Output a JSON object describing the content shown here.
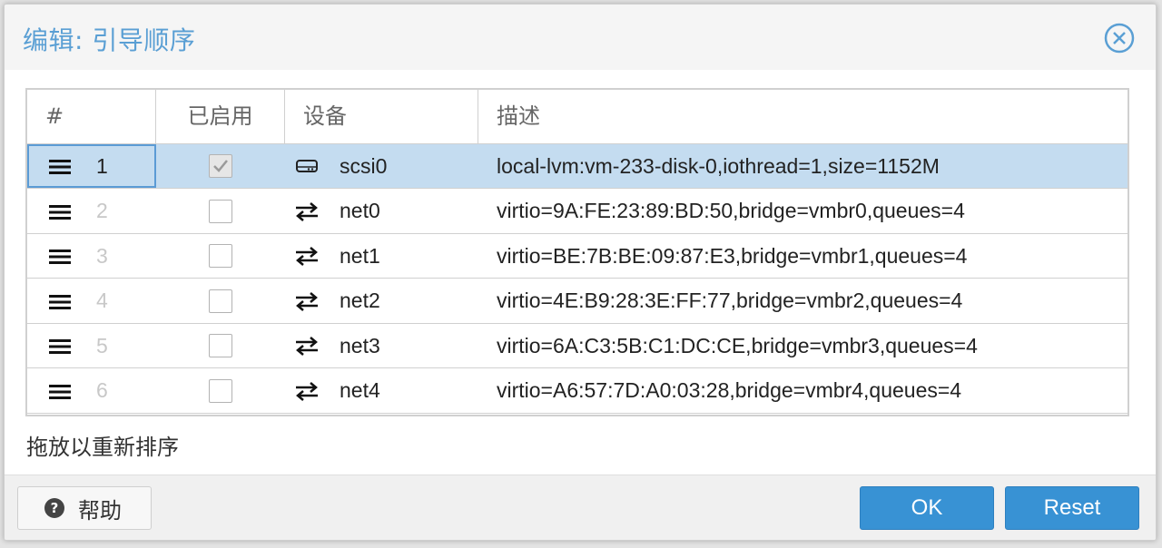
{
  "dialog": {
    "title": "编辑: 引导顺序",
    "hint": "拖放以重新排序"
  },
  "grid": {
    "columns": [
      "#",
      "已启用",
      "设备",
      "描述"
    ],
    "rows": [
      {
        "order": "1",
        "enabled": true,
        "device_icon": "hard-disk-icon",
        "device": "scsi0",
        "description": "local-lvm:vm-233-disk-0,iothread=1,size=1152M",
        "selected": true
      },
      {
        "order": "2",
        "enabled": false,
        "device_icon": "network-icon",
        "device": "net0",
        "description": "virtio=9A:FE:23:89:BD:50,bridge=vmbr0,queues=4",
        "selected": false
      },
      {
        "order": "3",
        "enabled": false,
        "device_icon": "network-icon",
        "device": "net1",
        "description": "virtio=BE:7B:BE:09:87:E3,bridge=vmbr1,queues=4",
        "selected": false
      },
      {
        "order": "4",
        "enabled": false,
        "device_icon": "network-icon",
        "device": "net2",
        "description": "virtio=4E:B9:28:3E:FF:77,bridge=vmbr2,queues=4",
        "selected": false
      },
      {
        "order": "5",
        "enabled": false,
        "device_icon": "network-icon",
        "device": "net3",
        "description": "virtio=6A:C3:5B:C1:DC:CE,bridge=vmbr3,queues=4",
        "selected": false
      },
      {
        "order": "6",
        "enabled": false,
        "device_icon": "network-icon",
        "device": "net4",
        "description": "virtio=A6:57:7D:A0:03:28,bridge=vmbr4,queues=4",
        "selected": false
      }
    ]
  },
  "footer": {
    "help_label": "帮助",
    "ok_label": "OK",
    "reset_label": "Reset"
  },
  "colors": {
    "accent": "#3892d4",
    "title": "#5a9fd4",
    "selected_row": "#c4dcf0"
  }
}
